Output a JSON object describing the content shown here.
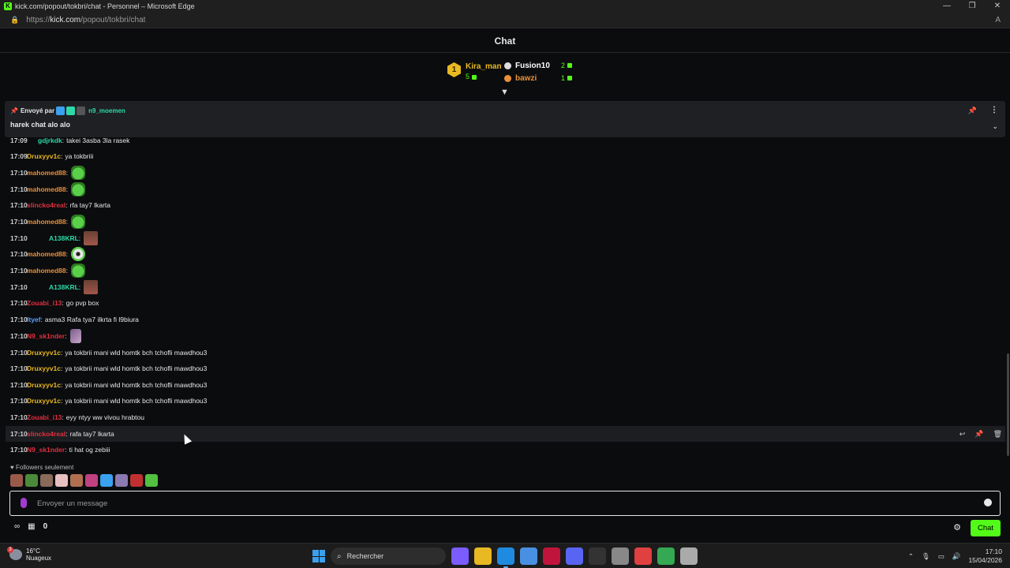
{
  "window": {
    "title": "kick.com/popout/tokbri/chat - Personnel – Microsoft Edge",
    "controls": [
      "—",
      "❐",
      "✕"
    ]
  },
  "address": {
    "prefix": "https://",
    "host": "kick.com",
    "path": "/popout/tokbri/chat"
  },
  "header": {
    "title": "Chat"
  },
  "leaderboard": {
    "first": {
      "rank": "1",
      "name": "Kira_man",
      "count": "5"
    },
    "others": [
      {
        "name": "Fusion10",
        "count": "2",
        "color": "#ffffff"
      },
      {
        "name": "bawzi",
        "count": "1",
        "color": "#e8913a"
      }
    ]
  },
  "pinned": {
    "sent_by_label": "Envoyé par",
    "user": "n9_moemen",
    "message": "harek chat alo alo"
  },
  "messages": [
    {
      "time": "17:09",
      "user": "gdjrkdk",
      "color": "#2ed9a7",
      "text": "takei 3asba 3la rasek",
      "badges": [
        "#e8b923"
      ]
    },
    {
      "time": "17:09",
      "user": "Druxyyv1c",
      "color": "#e8b923",
      "text": "ya tokbriii"
    },
    {
      "time": "17:10",
      "user": "mahomed88",
      "color": "#e8913a",
      "text": "",
      "emote": "pepe"
    },
    {
      "time": "17:10",
      "user": "mahomed88",
      "color": "#e8913a",
      "text": "",
      "emote": "pepe"
    },
    {
      "time": "17:10",
      "user": "slincko4real",
      "color": "#e0303f",
      "text": "rfa tay7 lkarta"
    },
    {
      "time": "17:10",
      "user": "mahomed88",
      "color": "#e8913a",
      "text": "",
      "emote": "pepe"
    },
    {
      "time": "17:10",
      "user": "A138KRL",
      "color": "#2ed9a7",
      "text": "",
      "emote": "face",
      "badges": [
        "#3aa0f0",
        "#777"
      ]
    },
    {
      "time": "17:10",
      "user": "mahomed88",
      "color": "#e8913a",
      "text": "",
      "emote": "eyes"
    },
    {
      "time": "17:10",
      "user": "mahomed88",
      "color": "#e8913a",
      "text": "",
      "emote": "pepe"
    },
    {
      "time": "17:10",
      "user": "A138KRL",
      "color": "#2ed9a7",
      "text": "",
      "emote": "face",
      "badges": [
        "#3aa0f0",
        "#777"
      ]
    },
    {
      "time": "17:10",
      "user": "Zouabi_i13",
      "color": "#e0303f",
      "text": "go pvp box"
    },
    {
      "time": "17:10",
      "user": "ltyef",
      "color": "#5aa0ff",
      "text": "asma3 Rafa tya7 ilkrta fi l9biura"
    },
    {
      "time": "17:10",
      "user": "N9_sk1nder",
      "color": "#e0303f",
      "text": "",
      "emote": "fig"
    },
    {
      "time": "17:10",
      "user": "Druxyyv1c",
      "color": "#e8b923",
      "text": "ya tokbrii mani wld homtk bch tchofli mawdhou3"
    },
    {
      "time": "17:10",
      "user": "Druxyyv1c",
      "color": "#e8b923",
      "text": "ya tokbrii mani wld homtk bch tchofli mawdhou3"
    },
    {
      "time": "17:10",
      "user": "Druxyyv1c",
      "color": "#e8b923",
      "text": "ya tokbrii mani wld homtk bch tchofli mawdhou3"
    },
    {
      "time": "17:10",
      "user": "Druxyyv1c",
      "color": "#e8b923",
      "text": "ya tokbrii mani wld homtk bch tchofli mawdhou3"
    },
    {
      "time": "17:10",
      "user": "Zouabi_i13",
      "color": "#e0303f",
      "text": "eyy ntyy ww vivou hrabtou"
    },
    {
      "time": "17:10",
      "user": "slincko4real",
      "color": "#e0303f",
      "text": "rafa tay7 lkarta",
      "hover": true
    },
    {
      "time": "17:10",
      "user": "N9_sk1nder",
      "color": "#e0303f",
      "text": "ti hat og zebiii"
    }
  ],
  "hover_actions": [
    "↩",
    "📌",
    "🗑"
  ],
  "followers_label": "Followers seulement",
  "emote_bar": [
    "#9a5a4a",
    "#4a8a3a",
    "#8a6a5a",
    "#e8c0c0",
    "#b07050",
    "#c04080",
    "#3aa0f0",
    "#8a7ab0",
    "#c03030",
    "#53c040"
  ],
  "input": {
    "placeholder": "Envoyer un message"
  },
  "bottom": {
    "points": "0",
    "chat_button": "Chat"
  },
  "taskbar": {
    "temp": "16°C",
    "weather": "Nuageux",
    "search": "Rechercher",
    "apps": [
      "#7a5cff",
      "#e8b923",
      "#1f8be0",
      "#4a90e2",
      "#c0143c",
      "#5865f2",
      "#333",
      "#888",
      "#e04040",
      "#34a853",
      "#aaa"
    ],
    "time": "17:10",
    "date": "15/04/2026"
  }
}
